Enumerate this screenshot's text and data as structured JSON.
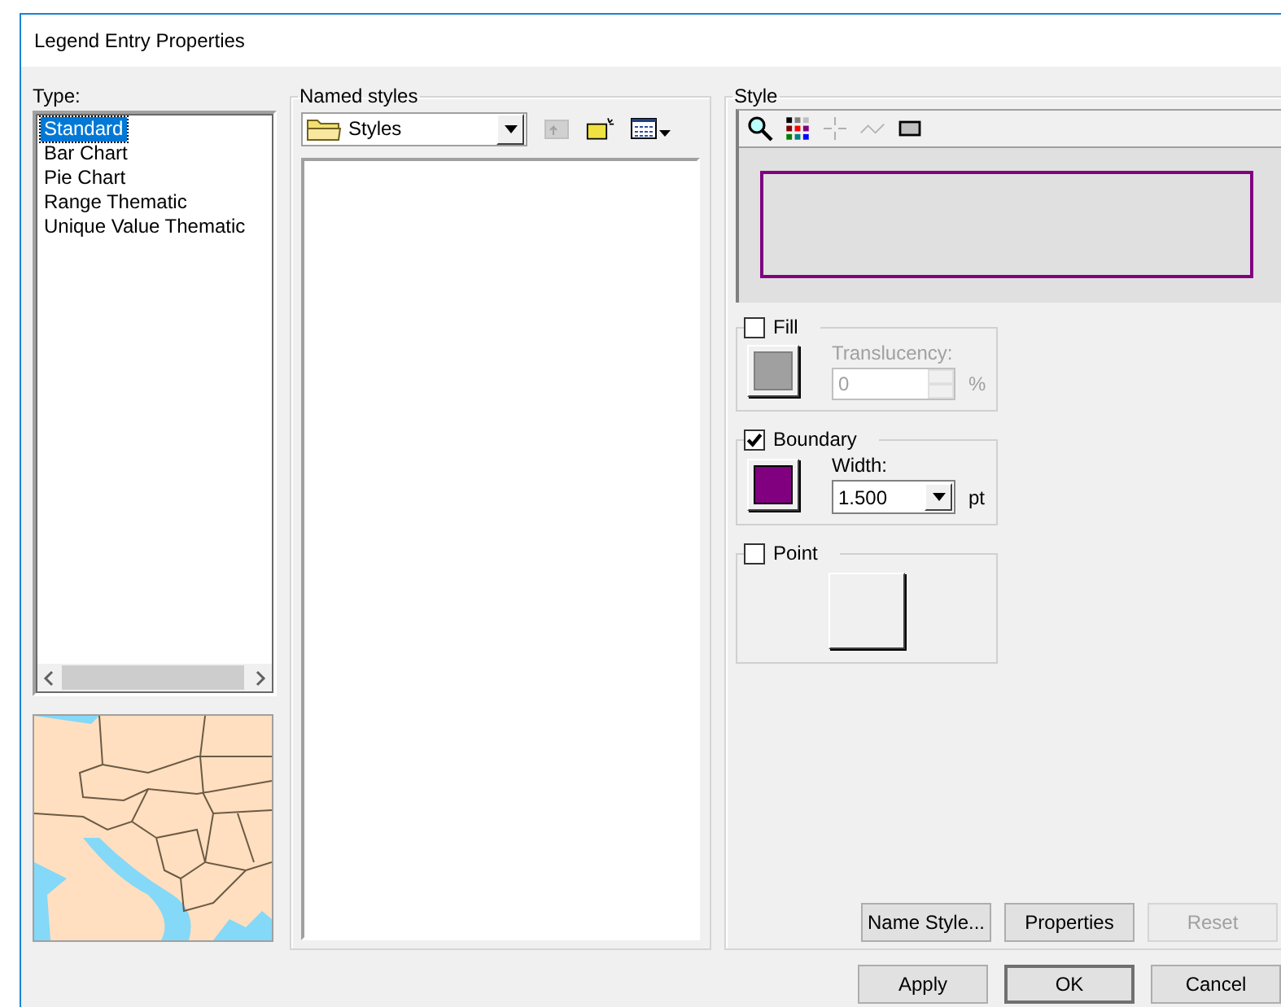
{
  "window": {
    "title": "Legend Entry Properties"
  },
  "type_list": {
    "label": "Type:",
    "items": [
      {
        "label": "Standard",
        "selected": true
      },
      {
        "label": "Bar Chart",
        "selected": false
      },
      {
        "label": "Pie Chart",
        "selected": false
      },
      {
        "label": "Range Thematic",
        "selected": false
      },
      {
        "label": "Unique Value Thematic",
        "selected": false
      }
    ]
  },
  "named_styles": {
    "title": "Named styles",
    "folder": "Styles"
  },
  "style": {
    "title": "Style",
    "fill": {
      "label": "Fill",
      "checked": false,
      "color": "#a0a0a0",
      "translucency_label": "Translucency:",
      "translucency_value": "0",
      "unit": "%"
    },
    "boundary": {
      "label": "Boundary",
      "checked": true,
      "color": "#800080",
      "width_label": "Width:",
      "width_value": "1.500",
      "unit": "pt"
    },
    "point": {
      "label": "Point",
      "checked": false
    },
    "buttons": [
      {
        "label": "Name Style...",
        "disabled": false
      },
      {
        "label": "Properties",
        "disabled": false
      },
      {
        "label": "Reset",
        "disabled": true
      }
    ]
  },
  "dialog_buttons": [
    {
      "label": "Apply",
      "default": false
    },
    {
      "label": "OK",
      "default": true
    },
    {
      "label": "Cancel",
      "default": false
    }
  ]
}
